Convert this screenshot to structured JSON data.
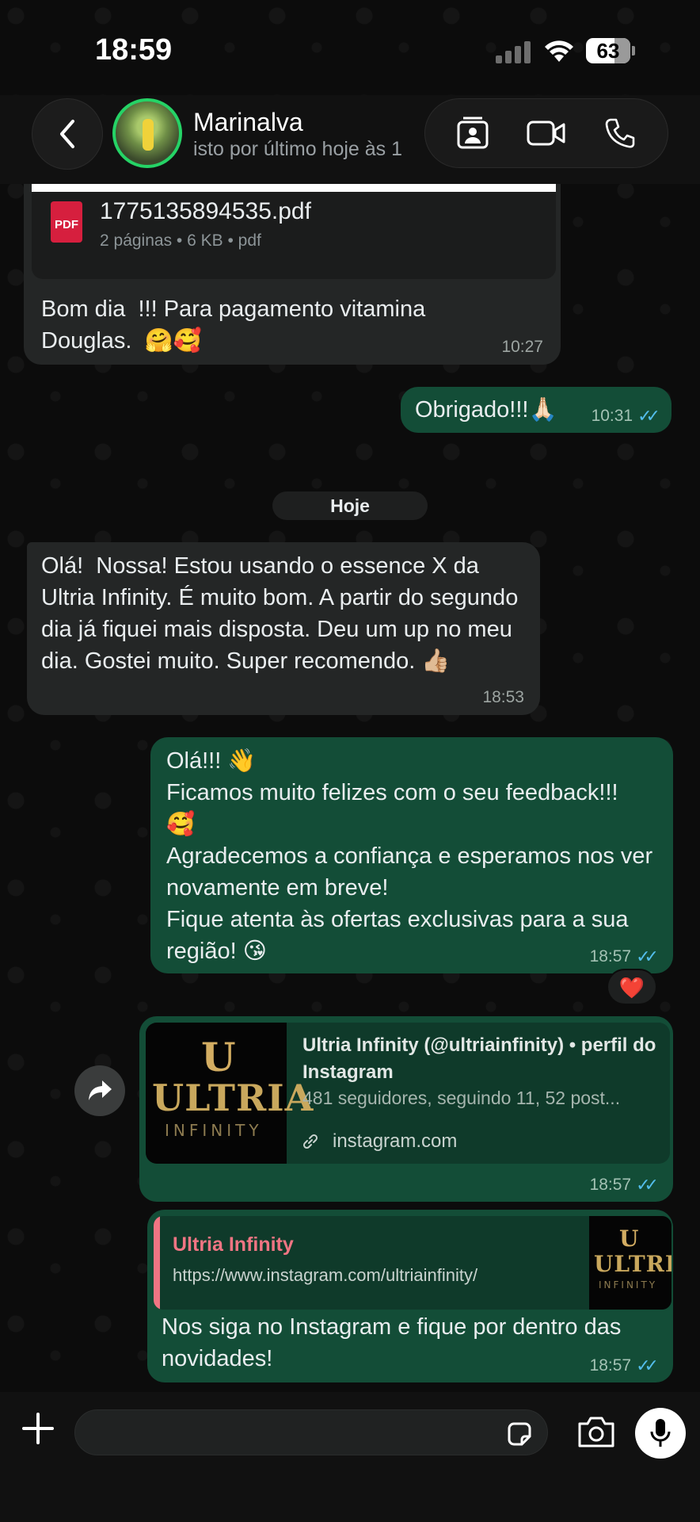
{
  "status_bar": {
    "time": "18:59",
    "battery": "63"
  },
  "header": {
    "contact_name": "Marinalva",
    "contact_status": "isto por último hoje às 1",
    "icons": [
      "chevron-left-icon",
      "contact-card-icon",
      "video-call-icon",
      "phone-icon"
    ]
  },
  "messages": {
    "pdf": {
      "filename": "1775135894535.pdf",
      "info": "2 páginas • 6 KB • pdf",
      "badge": "PDF"
    },
    "m1": {
      "text": "Bom dia  !!! Para pagamento vitamina Douglas.  🤗🥰",
      "time": "10:27"
    },
    "m2": {
      "text": "Obrigado!!!🙏🏻",
      "time": "10:31"
    },
    "date_divider": "Hoje",
    "m3": {
      "text": "Olá!  Nossa! Estou usando o essence X da Ultria Infinity. É muito bom. A partir do segundo dia já fiquei mais disposta. Deu um up no meu dia. Gostei muito. Super recomendo. 👍🏼",
      "time": "18:53"
    },
    "m4": {
      "text": "Olá!!! 👋\nFicamos muito felizes com o seu feedback!!!\n🥰\nAgradecemos a confiança e esperamos nos ver novamente em breve!\nFique atenta às ofertas exclusivas para a sua região! 😘",
      "time": "18:57",
      "reaction": "❤️"
    },
    "m5": {
      "link_title": "Ultria Infinity (@ultriainfinity) • perfil do Instagram",
      "link_desc": "481 seguidores, seguindo 11, 52 post...",
      "link_domain": "instagram.com",
      "time": "18:57"
    },
    "m6": {
      "quote_title": "Ultria Infinity",
      "quote_url": "https://www.instagram.com/ultriainfinity/",
      "text": "Nos siga no Instagram e fique por dentro das novidades!",
      "time": "18:57"
    },
    "logo": {
      "mark": "U",
      "word": "ULTRIA",
      "sub": "INFINITY"
    }
  },
  "colors": {
    "outgoing": "#134d37",
    "incoming": "#242626",
    "read_ticks": "#53bdeb",
    "quote_accent": "#f07583"
  }
}
